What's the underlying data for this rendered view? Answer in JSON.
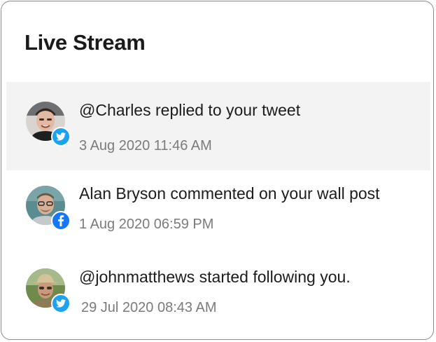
{
  "header": {
    "title": "Live Stream"
  },
  "items": [
    {
      "text": "@Charles replied to your tweet",
      "time": "3 Aug 2020 11:46 AM",
      "source": "twitter-icon",
      "active": true
    },
    {
      "text": "Alan Bryson commented on your wall post",
      "time": "1 Aug 2020 06:59 PM",
      "source": "facebook-icon",
      "active": false
    },
    {
      "text": "@johnmatthews started following you.",
      "time": "29 Jul 2020 08:43 AM",
      "source": "twitter-icon",
      "active": false
    }
  ],
  "colors": {
    "twitter": "#1da1f2",
    "facebook": "#1877f2",
    "active_row": "#f3f3f3"
  }
}
